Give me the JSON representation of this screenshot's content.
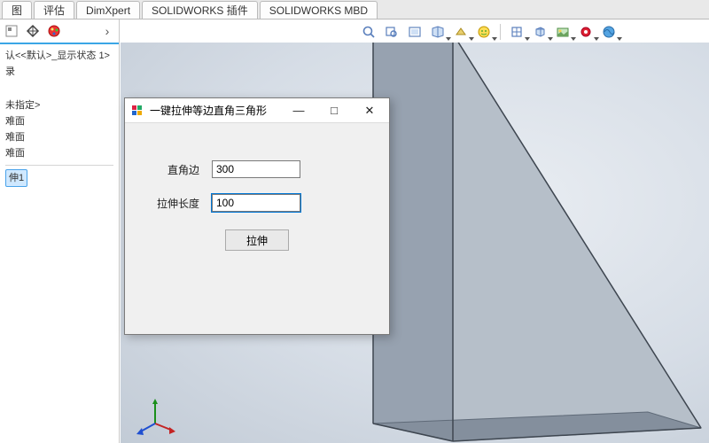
{
  "tabs": [
    "图",
    "评估",
    "DimXpert",
    "SOLIDWORKS 插件",
    "SOLIDWORKS MBD"
  ],
  "toolbar_icons": [
    {
      "name": "zoom-icon"
    },
    {
      "name": "pan-icon"
    },
    {
      "name": "rotate-icon"
    },
    {
      "name": "section-icon",
      "dd": true
    },
    {
      "name": "display-style-icon",
      "dd": true
    },
    {
      "name": "smiley-icon",
      "dd": true
    },
    {
      "name": "sep"
    },
    {
      "name": "view-orientation-icon",
      "dd": true
    },
    {
      "name": "appearance-cube-icon",
      "dd": true
    },
    {
      "name": "scene-icon",
      "dd": true
    },
    {
      "name": "paint-icon",
      "dd": true
    },
    {
      "name": "globe-icon",
      "dd": true
    }
  ],
  "tree": {
    "config_line": "认<<默认>_显示状态 1>",
    "history_label": "录",
    "unspecified": "未指定>",
    "planes": [
      "难面",
      "难面",
      "难面"
    ],
    "feature": "伸1"
  },
  "dialog": {
    "title": "一键拉伸等边直角三角形",
    "field1_label": "直角边",
    "field1_value": "300",
    "field2_label": "拉伸长度",
    "field2_value": "100",
    "button_label": "拉伸",
    "min_label": "—",
    "max_label": "□",
    "close_label": "✕"
  }
}
